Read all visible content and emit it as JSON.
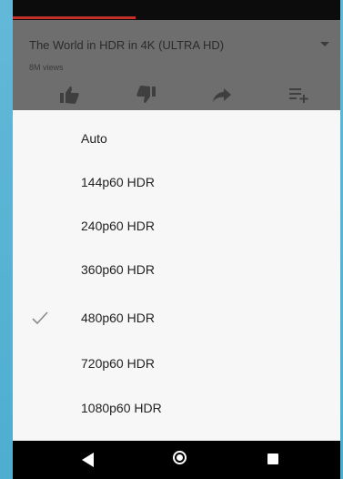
{
  "video": {
    "title": "The World in HDR in 4K (ULTRA HD)",
    "views": "8M views",
    "progress_fraction": 0.375,
    "accent_color": "#c4302b"
  },
  "actions": [
    {
      "name": "like-icon"
    },
    {
      "name": "dislike-icon"
    },
    {
      "name": "share-icon"
    },
    {
      "name": "add-to-playlist-icon"
    }
  ],
  "quality_menu": {
    "selected": "480p60 HDR",
    "options": [
      {
        "label": "Auto",
        "selected": false
      },
      {
        "label": "144p60 HDR",
        "selected": false
      },
      {
        "label": "240p60 HDR",
        "selected": false
      },
      {
        "label": "360p60 HDR",
        "selected": false
      },
      {
        "label": "480p60 HDR",
        "selected": true
      },
      {
        "label": "720p60 HDR",
        "selected": false
      },
      {
        "label": "1080p60 HDR",
        "selected": false
      }
    ]
  },
  "navbar": {
    "buttons": [
      "back-icon",
      "home-icon",
      "recent-apps-icon"
    ]
  }
}
